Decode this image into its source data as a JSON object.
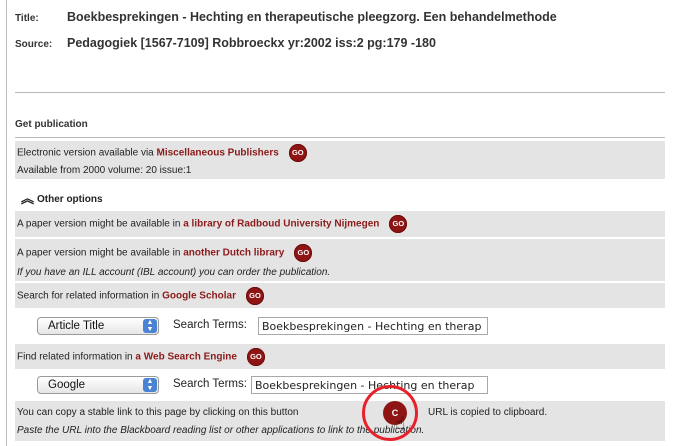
{
  "record": {
    "title_label": "Title:",
    "title_value": "Boekbesprekingen - Hechting en therapeutische pleegzorg. Een behandelmethode",
    "source_label": "Source:",
    "source_value": "Pedagogiek [1567-7109] Robbroeckx yr:2002 iss:2 pg:179 -180"
  },
  "get_publication": {
    "heading": "Get publication",
    "electronic": {
      "text": "Electronic version available via ",
      "link": "Miscellaneous Publishers",
      "go": "GO",
      "availability": "Available from 2000 volume: 20 issue:1"
    },
    "other_options": {
      "icon": "chevron-up-icon",
      "label": "Other options"
    },
    "library_radboud": {
      "text": "A paper version might be available in ",
      "link": "a library of Radboud University Nijmegen",
      "go": "GO"
    },
    "dutch_library": {
      "text": "A paper version might be available in ",
      "link": "another Dutch library",
      "go": "GO",
      "note": "If you have an ILL account (IBL account) you can order the publication."
    },
    "google_scholar": {
      "text": "Search for related information in ",
      "link": "Google Scholar",
      "go": "GO",
      "select_value": "Article Title",
      "search_label": "Search Terms:",
      "search_value": "Boekbesprekingen - Hechting en therap"
    },
    "web_search": {
      "text": "Find related information in ",
      "link": "a Web Search Engine",
      "go": "GO",
      "select_value": "Google",
      "search_label": "Search Terms:",
      "search_value": "Boekbesprekingen - Hechting en therap"
    },
    "stable_link": {
      "text_before": "You can copy a stable link to this page by clicking on this button",
      "button": "C",
      "text_after": "URL is copied to clipboard.",
      "note": "Paste the URL into the Blackboard reading list or other applications to link to the publication."
    }
  },
  "colors": {
    "link": "#8c1a1a",
    "go_button": "#8f1414",
    "row_gray": "#e4e4e4",
    "highlight": "#e8202a"
  }
}
